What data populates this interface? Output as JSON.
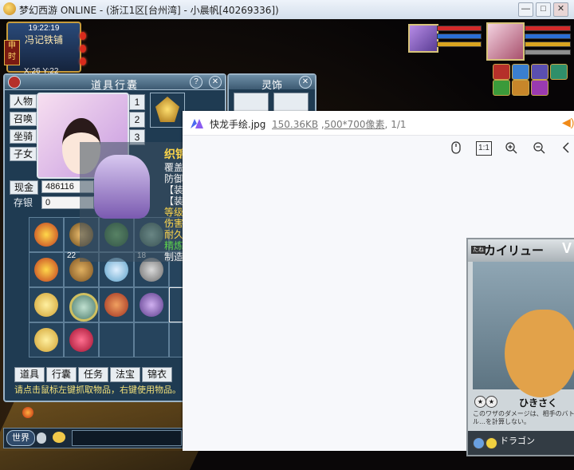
{
  "window": {
    "title": "梦幻西游 ONLINE - (浙江1区[台州湾] - 小晨帆[40269336])",
    "min_label": "—",
    "max_label": "□",
    "close_label": "✕"
  },
  "hud": {
    "time": "19:22:19",
    "location": "冯记铁铺",
    "shichen": "申时",
    "x_coord": "X:26",
    "y_coord": "Y:22"
  },
  "inventory": {
    "title": "道具行囊",
    "help_label": "?",
    "close_label": "✕",
    "side_tabs": [
      {
        "label": "人物"
      },
      {
        "label": "召唤"
      },
      {
        "label": "坐骑"
      },
      {
        "label": "子女"
      }
    ],
    "page_tabs": [
      "1",
      "2",
      "3"
    ],
    "cash_label": "现金",
    "cash_value": "486116",
    "savings_label": "存银",
    "savings_value": "0",
    "quantities": {
      "item_22": "22",
      "item_18": "18"
    },
    "bottom_tabs": [
      {
        "label": "道具"
      },
      {
        "label": "行囊"
      },
      {
        "label": "任务"
      },
      {
        "label": "法宝"
      },
      {
        "label": "锦衣"
      }
    ],
    "hint": "请点击鼠标左键抓取物品，右键使用物品。"
  },
  "tooltip_lines": [
    "织锦",
    "覆盖",
    "防御",
    "【装",
    "【装",
    "等级",
    "伤害",
    "耐久",
    "精炼",
    "制造"
  ],
  "lingshi": {
    "title": "灵饰",
    "close_label": "✕"
  },
  "chat": {
    "channel": "世界"
  },
  "viewer": {
    "filename": "快龙手绘.jpg",
    "filesize": "150.36KB",
    "dimensions": "500*700像素",
    "page": "1/1",
    "tools": [
      "mouse-icon",
      "1:1",
      "zoom-in-icon",
      "zoom-out-icon",
      "prev-icon"
    ],
    "one_to_one": "1:1"
  },
  "card": {
    "title": "カイリュー",
    "stage_label": "たね",
    "v_mark": "V",
    "attack_name": "ひきさく",
    "desc": "このワザのダメージは、相手のバトル…を計算しない。",
    "footer_name": "ドラゴン"
  },
  "colors": {
    "accent_gold": "#ffd74a",
    "panel_blue": "#1f3b52",
    "hp_red": "#d32a2a",
    "mp_blue": "#2b6fd6"
  }
}
